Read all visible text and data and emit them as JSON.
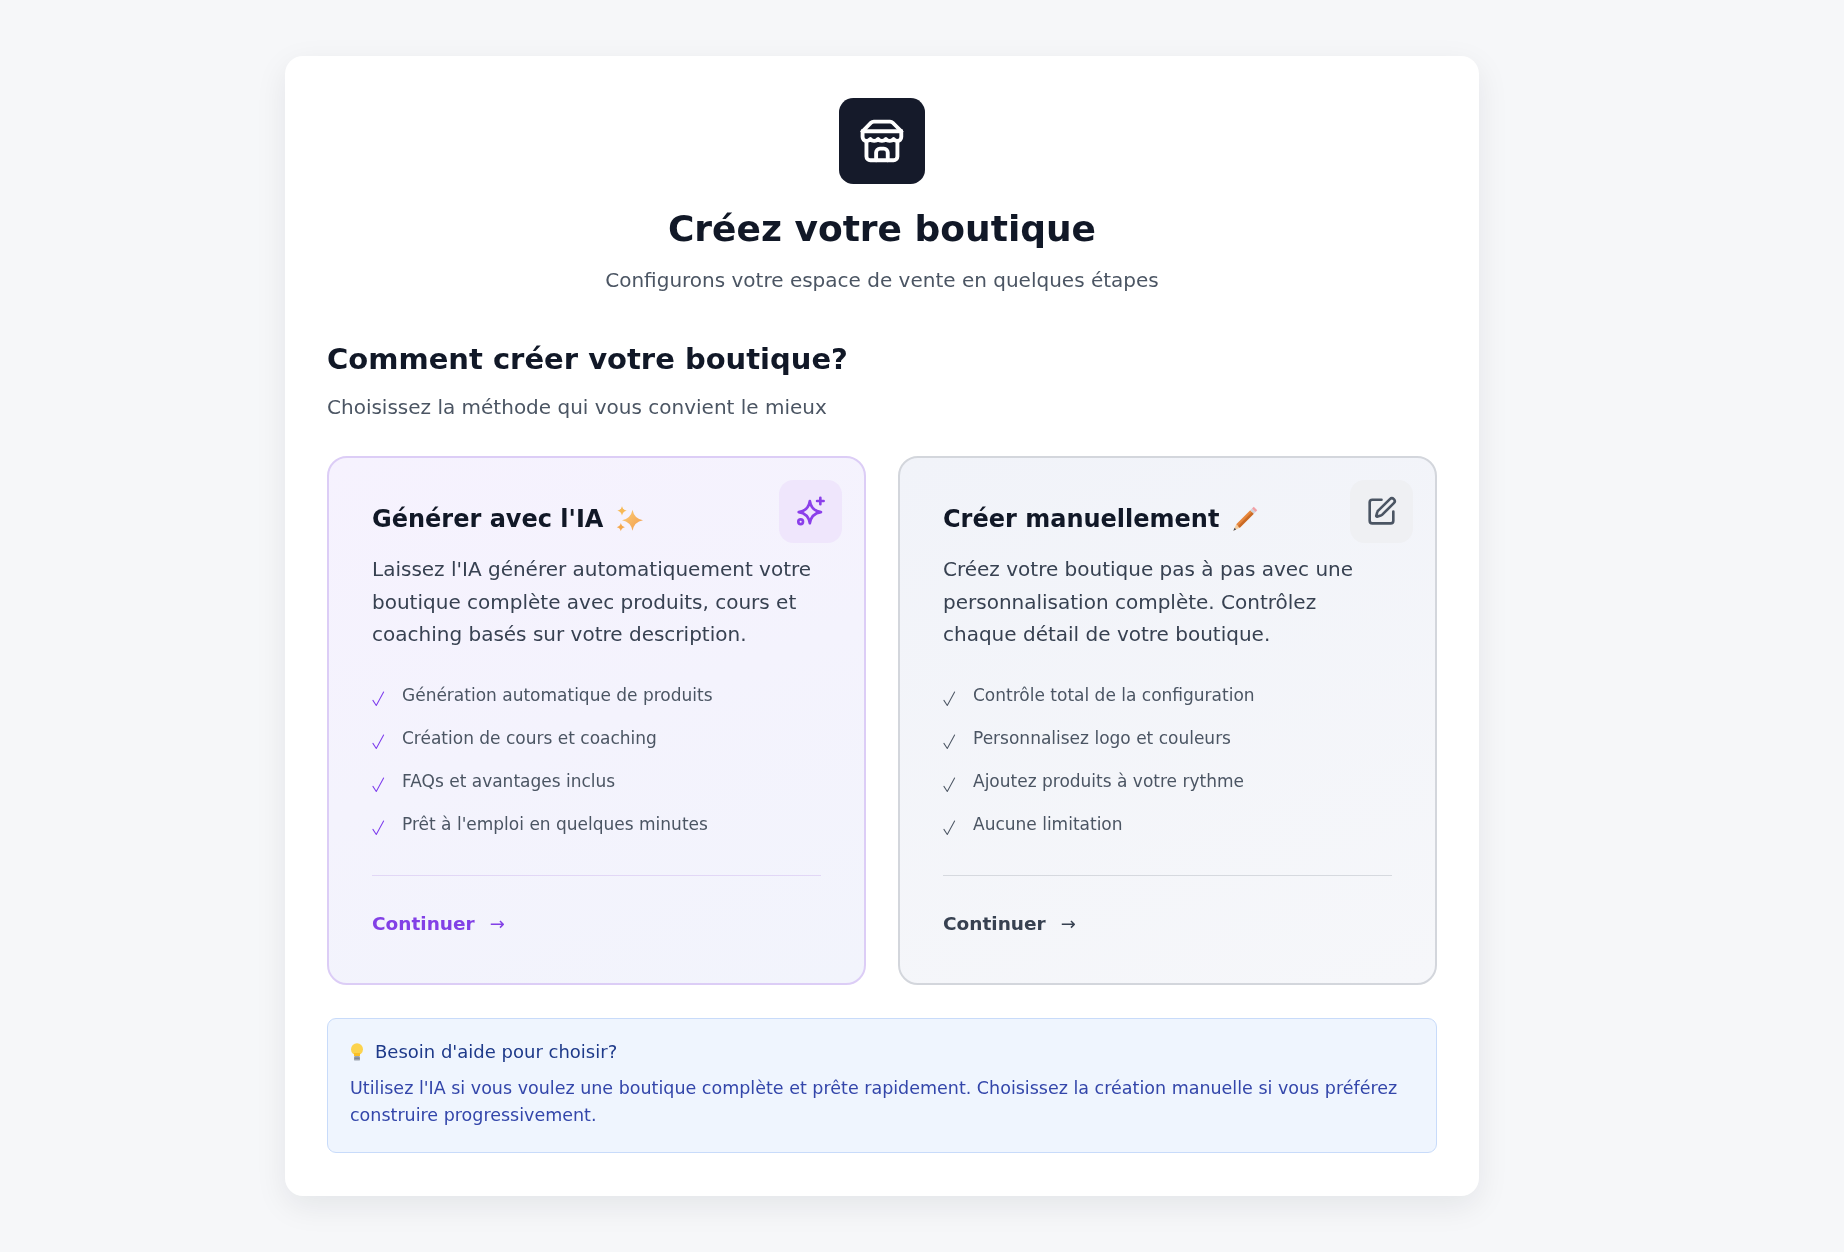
{
  "header": {
    "title": "Créez votre boutique",
    "subtitle": "Configurons votre espace de vente en quelques étapes"
  },
  "section": {
    "title": "Comment créer votre boutique?",
    "subtitle": "Choisissez la méthode qui vous convient le mieux"
  },
  "options": [
    {
      "kind": "ai",
      "title": "Générer avec l'IA",
      "description": "Laissez l'IA générer automatiquement votre boutique complète avec produits, cours et coaching basés sur votre description.",
      "features": [
        "Génération automatique de produits",
        "Création de cours et coaching",
        "FAQs et avantages inclus",
        "Prêt à l'emploi en quelques minutes"
      ],
      "action": {
        "label": "Continuer",
        "arrow": "→"
      }
    },
    {
      "kind": "manual",
      "title": "Créer manuellement",
      "description": "Créez votre boutique pas à pas avec une personnalisation complète. Contrôlez chaque détail de votre boutique.",
      "features": [
        "Contrôle total de la configuration",
        "Personnalisez logo et couleurs",
        "Ajoutez produits à votre rythme",
        "Aucune limitation"
      ],
      "action": {
        "label": "Continuer",
        "arrow": "→"
      }
    }
  ],
  "help": {
    "title": "Besoin d'aide pour choisir?",
    "text": "Utilisez l'IA si vous voulez une boutique complète et prête rapidement. Choisissez la création manuelle si vous préférez construire progressivement."
  }
}
